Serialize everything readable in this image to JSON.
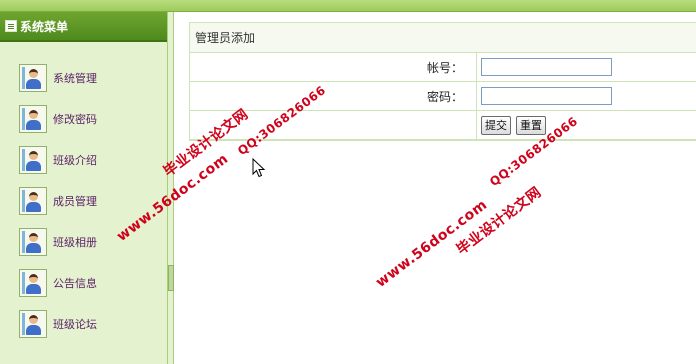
{
  "sidebar": {
    "title": "系统菜单",
    "items": [
      {
        "label": "系统管理",
        "icon": "user-icon"
      },
      {
        "label": "修改密码",
        "icon": "user-icon"
      },
      {
        "label": "班级介绍",
        "icon": "user-icon"
      },
      {
        "label": "成员管理",
        "icon": "user-icon"
      },
      {
        "label": "班级相册",
        "icon": "user-icon"
      },
      {
        "label": "公告信息",
        "icon": "user-icon"
      },
      {
        "label": "班级论坛",
        "icon": "user-icon"
      }
    ]
  },
  "panel": {
    "title": "管理员添加",
    "username_label": "帐号：",
    "username_value": "",
    "password_label": "密码：",
    "password_value": "",
    "submit_label": "提交",
    "reset_label": "重置"
  },
  "watermarks": {
    "site": "www.56doc.com",
    "name": "毕业设计论文网",
    "qq": "QQ:306826066"
  },
  "colors": {
    "header_green": "#4f8a1e",
    "sidebar_bg": "#e4f2cf",
    "watermark_red": "#d0021b",
    "menu_text": "#5a1f66"
  }
}
